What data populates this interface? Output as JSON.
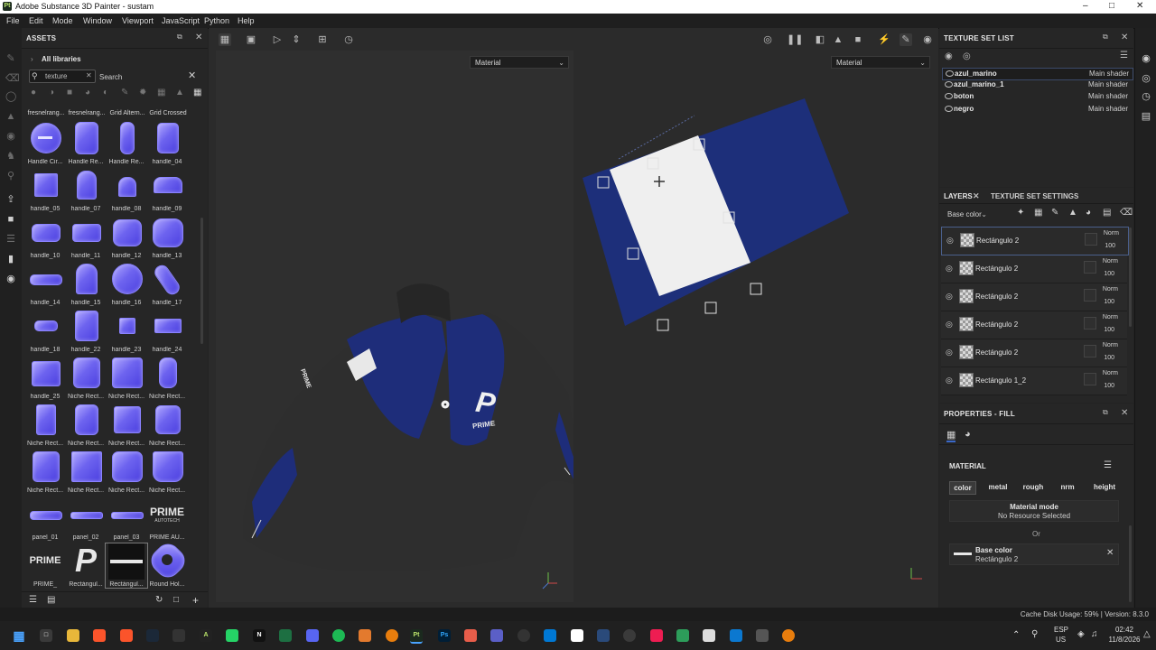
{
  "window": {
    "title": "Adobe Substance 3D Painter - sustam",
    "logo": "Pt"
  },
  "menu": [
    "File",
    "Edit",
    "Mode",
    "Window",
    "Viewport",
    "JavaScript",
    "Python",
    "Help"
  ],
  "assets": {
    "title": "ASSETS",
    "breadcrumb": "All libraries",
    "search_value": "texture",
    "search_label": "Search",
    "top_row_labels": [
      "fresnelrang...",
      "fresnelrang...",
      "Grid Altern...",
      "Grid Crossed"
    ],
    "items": [
      {
        "label": "Handle Cir..."
      },
      {
        "label": "Handle Re..."
      },
      {
        "label": "Handle Re..."
      },
      {
        "label": "handle_04"
      },
      {
        "label": "handle_05"
      },
      {
        "label": "handle_07"
      },
      {
        "label": "handle_08"
      },
      {
        "label": "handle_09"
      },
      {
        "label": "handle_10"
      },
      {
        "label": "handle_11"
      },
      {
        "label": "handle_12"
      },
      {
        "label": "handle_13"
      },
      {
        "label": "handle_14"
      },
      {
        "label": "handle_15"
      },
      {
        "label": "handle_16"
      },
      {
        "label": "handle_17"
      },
      {
        "label": "handle_18"
      },
      {
        "label": "handle_22"
      },
      {
        "label": "handle_23"
      },
      {
        "label": "handle_24"
      },
      {
        "label": "handle_25"
      },
      {
        "label": "Niche Rect..."
      },
      {
        "label": "Niche Rect..."
      },
      {
        "label": "Niche Rect..."
      },
      {
        "label": "Niche Rect..."
      },
      {
        "label": "Niche Rect..."
      },
      {
        "label": "Niche Rect..."
      },
      {
        "label": "Niche Rect..."
      },
      {
        "label": "Niche Rect..."
      },
      {
        "label": "Niche Rect..."
      },
      {
        "label": "Niche Rect..."
      },
      {
        "label": "Niche Rect..."
      },
      {
        "label": "panel_01"
      },
      {
        "label": "panel_02"
      },
      {
        "label": "panel_03"
      },
      {
        "label": "PRIME AU..."
      },
      {
        "label": "PRIME_"
      },
      {
        "label": "Rectángul..."
      },
      {
        "label": "Rectángul..."
      },
      {
        "label": "Round Hol..."
      }
    ],
    "logo_text_prime": "PRIME",
    "logo_text_autotech": "AUTOTECH"
  },
  "viewport": {
    "left_dropdown": "Material",
    "right_dropdown": "Material",
    "decal_letter": "P",
    "decal_text": "PRIME"
  },
  "texture_set_list": {
    "title": "TEXTURE SET LIST",
    "rows": [
      {
        "name": "azul_marino",
        "shader": "Main shader"
      },
      {
        "name": "azul_marino_1",
        "shader": "Main shader"
      },
      {
        "name": "boton",
        "shader": "Main shader"
      },
      {
        "name": "negro",
        "shader": "Main shader"
      }
    ]
  },
  "layers": {
    "tab_layers": "LAYERS",
    "tab_settings": "TEXTURE SET SETTINGS",
    "channel": "Base color",
    "rows": [
      {
        "name": "Rectángulo 2",
        "blend": "Norm",
        "opacity": "100"
      },
      {
        "name": "Rectángulo 2",
        "blend": "Norm",
        "opacity": "100"
      },
      {
        "name": "Rectángulo 2",
        "blend": "Norm",
        "opacity": "100"
      },
      {
        "name": "Rectángulo 2",
        "blend": "Norm",
        "opacity": "100"
      },
      {
        "name": "Rectángulo 2",
        "blend": "Norm",
        "opacity": "100"
      },
      {
        "name": "Rectángulo 1_2",
        "blend": "Norm",
        "opacity": "100"
      }
    ]
  },
  "properties": {
    "title": "PROPERTIES - FILL",
    "section": "MATERIAL",
    "chips": [
      "color",
      "metal",
      "rough",
      "nrm",
      "height"
    ],
    "material_mode_label": "Material mode",
    "material_mode_value": "No Resource Selected",
    "or_label": "Or",
    "base_color_label": "Base color",
    "base_color_value": "Rectángulo 2"
  },
  "status": {
    "text": "Cache Disk Usage:  59% | Version: 8.3.0"
  },
  "taskbar": {
    "lang": "ESP",
    "region": "US",
    "time": "02:42",
    "date": "11/8/2026"
  },
  "colors": {
    "accent": "#3a68c8",
    "navy": "#1d2f7a",
    "asset_purple": "#6d63ef"
  }
}
